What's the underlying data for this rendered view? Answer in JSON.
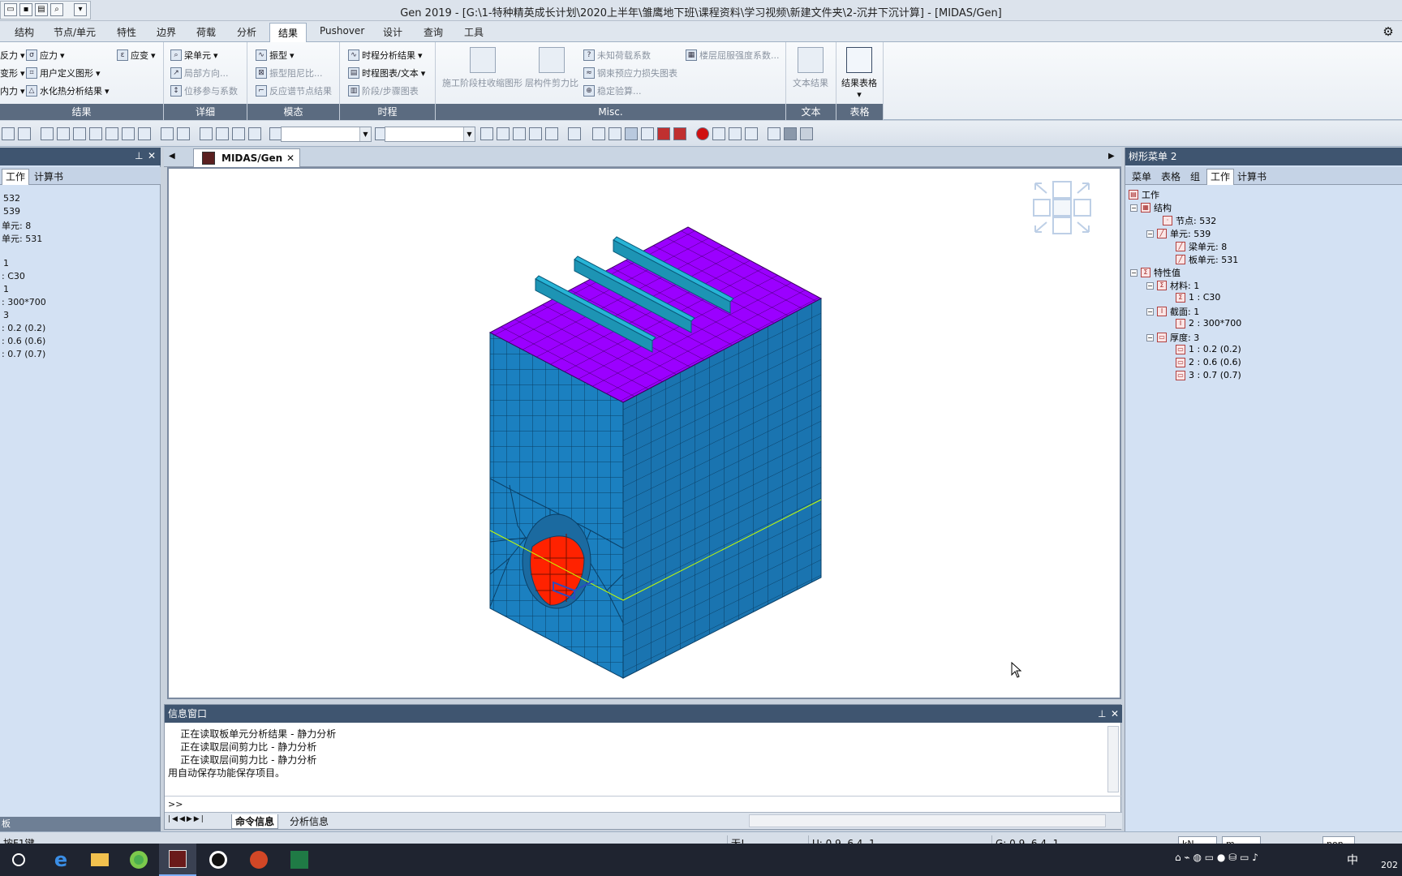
{
  "window": {
    "title": "Gen 2019 - [G:\\1-特种精英成长计划\\2020上半年\\雏鹰地下班\\课程资料\\学习视频\\新建文件夹\\2-沉井下沉计算] - [MIDAS/Gen]"
  },
  "ribbon_tabs": [
    "结构",
    "节点/单元",
    "特性",
    "边界",
    "荷载",
    "分析",
    "结果",
    "Pushover",
    "设计",
    "查询",
    "工具"
  ],
  "active_tab": "结果",
  "ribbon": {
    "group_result": {
      "label": "结果",
      "items": [
        "反力",
        "应力",
        "应变",
        "变形",
        "用户定义图形",
        "内力",
        "水化热分析结果"
      ]
    },
    "group_detail": {
      "label": "详细",
      "items": [
        "梁单元",
        "局部方向...",
        "位移参与系数"
      ]
    },
    "group_mode": {
      "label": "模态",
      "items": [
        "振型",
        "振型阻尼比...",
        "反应谱节点结果"
      ]
    },
    "group_time": {
      "label": "时程",
      "items": [
        "时程分析结果",
        "时程图表/文本",
        "阶段/步骤图表"
      ]
    },
    "group_misc": {
      "label": "Misc.",
      "big": [
        "施工阶段柱收缩图形",
        "层构件剪力比"
      ],
      "items": [
        "未知荷载系数",
        "钢束预应力损失图表",
        "稳定验算...",
        "楼层屈服强度系数..."
      ]
    },
    "group_text": {
      "label": "文本",
      "big": "文本结果"
    },
    "group_table": {
      "label": "表格",
      "big": "结果表格"
    }
  },
  "left_panel": {
    "tabs": [
      "工作",
      "计算书"
    ],
    "lines": [
      "532",
      "539",
      "单元: 8",
      "单元: 531",
      "1",
      ": C30",
      "1",
      ": 300*700",
      "3",
      ": 0.2 (0.2)",
      ": 0.6 (0.6)",
      ": 0.7 (0.7)"
    ],
    "footer": "板"
  },
  "doc_tab": {
    "label": "MIDAS/Gen"
  },
  "info_window": {
    "title": "信息窗口",
    "log": [
      "    正在读取板单元分析结果 - 静力分析",
      "    正在读取层间剪力比 - 静力分析",
      "    正在读取层间剪力比 - 静力分析",
      "用自动保存功能保存项目。"
    ],
    "prompt": ">>",
    "tabs": [
      "命令信息",
      "分析信息"
    ]
  },
  "right_panel": {
    "title": "树形菜单 2",
    "tabs": [
      "菜单",
      "表格",
      "组",
      "工作",
      "计算书"
    ],
    "tree": [
      {
        "level": 0,
        "label": "工作"
      },
      {
        "level": 1,
        "label": "结构"
      },
      {
        "level": 2,
        "label": "节点: 532"
      },
      {
        "level": 2,
        "label": "单元: 539"
      },
      {
        "level": 3,
        "label": "梁单元: 8"
      },
      {
        "level": 3,
        "label": "板单元: 531"
      },
      {
        "level": 1,
        "label": "特性值"
      },
      {
        "level": 2,
        "label": "材料: 1"
      },
      {
        "level": 3,
        "label": "1 : C30"
      },
      {
        "level": 2,
        "label": "截面: 1"
      },
      {
        "level": 3,
        "label": "2 : 300*700"
      },
      {
        "level": 2,
        "label": "厚度: 3"
      },
      {
        "level": 3,
        "label": "1 : 0.2 (0.2)"
      },
      {
        "level": 3,
        "label": "2 : 0.6 (0.6)"
      },
      {
        "level": 3,
        "label": "3 : 0.7 (0.7)"
      }
    ]
  },
  "status": {
    "hint": "按F1键",
    "none": "无!",
    "ucs": "U: 0.9, 6.4, 1",
    "gcs": "G: 0.9, 6.4, 1",
    "force_unit": "kN",
    "length_unit": "m",
    "none_combo": "non"
  },
  "taskbar": {
    "ime": "中",
    "year": "202"
  },
  "colors": {
    "mesh": "#1b80c0",
    "top": "#9b00ff",
    "beam": "#27b4d6",
    "opening": "#ff2200",
    "panel_head": "#3f5570"
  }
}
